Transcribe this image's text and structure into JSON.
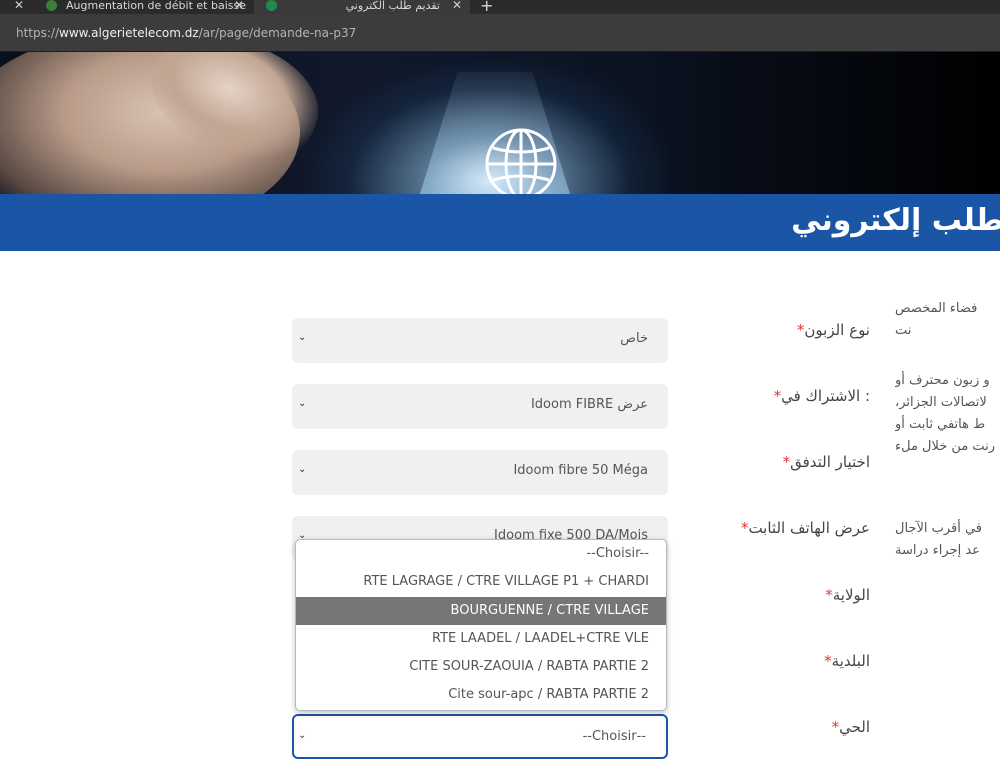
{
  "browser": {
    "tabs": [
      {
        "title": "Augmentation de débit et baisse"
      },
      {
        "title": "تقديم طلب الكتروني"
      }
    ],
    "new_tab": "+",
    "url_prefix": "https://",
    "url_domain": "www.algerietelecom.dz",
    "url_path": "/ar/page/demande-na-p37"
  },
  "banner": {
    "title": "طلب إلكتروني"
  },
  "side_text": [
    "فضاء المخصص",
    "نت",
    "و زبون محترف أو",
    "لاتصالات الجزائر،",
    "ط هاتفي ثابت أو",
    "رنت من خلال ملء",
    "في أقرب الآجال",
    "عد إجراء دراسة"
  ],
  "form": {
    "fields": [
      {
        "label": "نوع الزبون",
        "value": "خاص"
      },
      {
        "label": ": الاشتراك في",
        "value": "عرض Idoom FIBRE"
      },
      {
        "label": "اختيار التدفق",
        "value": "Idoom fibre 50 Méga"
      },
      {
        "label": "عرض الهاتف الثابت",
        "value": "Idoom fixe 500 DA/Mois"
      },
      {
        "label": "الولاية"
      },
      {
        "label": "البلدية"
      },
      {
        "label": "الحي",
        "value": "--Choisir--"
      }
    ],
    "required_mark": "*"
  },
  "dropdown": {
    "options": [
      "--Choisir--",
      "RTE LAGRAGE / CTRE VILLAGE P1 + CHARDI",
      "BOURGUENNE / CTRE VILLAGE",
      "RTE LAADEL / LAADEL+CTRE VLE",
      "CITE SOUR-ZAOUIA / RABTA PARTIE 2",
      "Cite sour-apc / RABTA PARTIE 2"
    ],
    "highlighted": "BOURGUENNE / CTRE VILLAGE"
  },
  "icons": {
    "close": "close-icon",
    "chevron": "chevron-down-icon",
    "globe": "globe-icon"
  },
  "colors": {
    "brand_blue": "#1a55a6",
    "required_red": "#d83a3a",
    "highlight_gray": "#767676"
  }
}
